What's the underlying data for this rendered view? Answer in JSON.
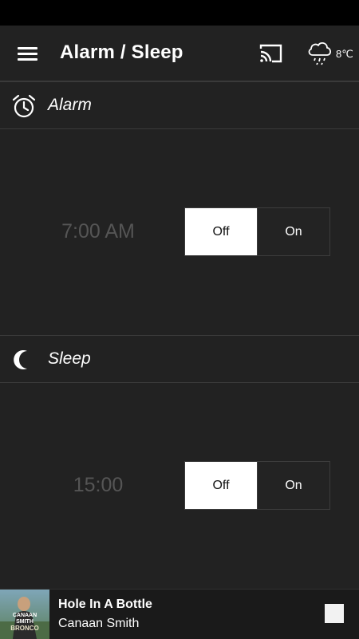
{
  "app": {
    "title": "Alarm / Sleep",
    "menu_icon": "hamburger-menu-icon",
    "cast_icon": "cast-icon",
    "weather": {
      "icon": "rain-cloud-icon",
      "temperature": "8℃"
    }
  },
  "sections": {
    "alarm": {
      "label": "Alarm",
      "icon": "alarm-clock-icon",
      "time": "7:00 AM",
      "toggle": {
        "off_label": "Off",
        "on_label": "On",
        "selected": "Off"
      }
    },
    "sleep": {
      "label": "Sleep",
      "icon": "moon-icon",
      "time": "15:00",
      "toggle": {
        "off_label": "Off",
        "on_label": "On",
        "selected": "Off"
      }
    }
  },
  "player": {
    "track_title": "Hole In A Bottle",
    "artist": "Canaan Smith",
    "album_art_text": "CANAAN SMITH BRONCO",
    "stop_icon": "stop-icon"
  },
  "colors": {
    "background": "#222222",
    "divider": "#3a3a3a",
    "toggle_active": "#ffffff",
    "time_text": "#555555"
  }
}
